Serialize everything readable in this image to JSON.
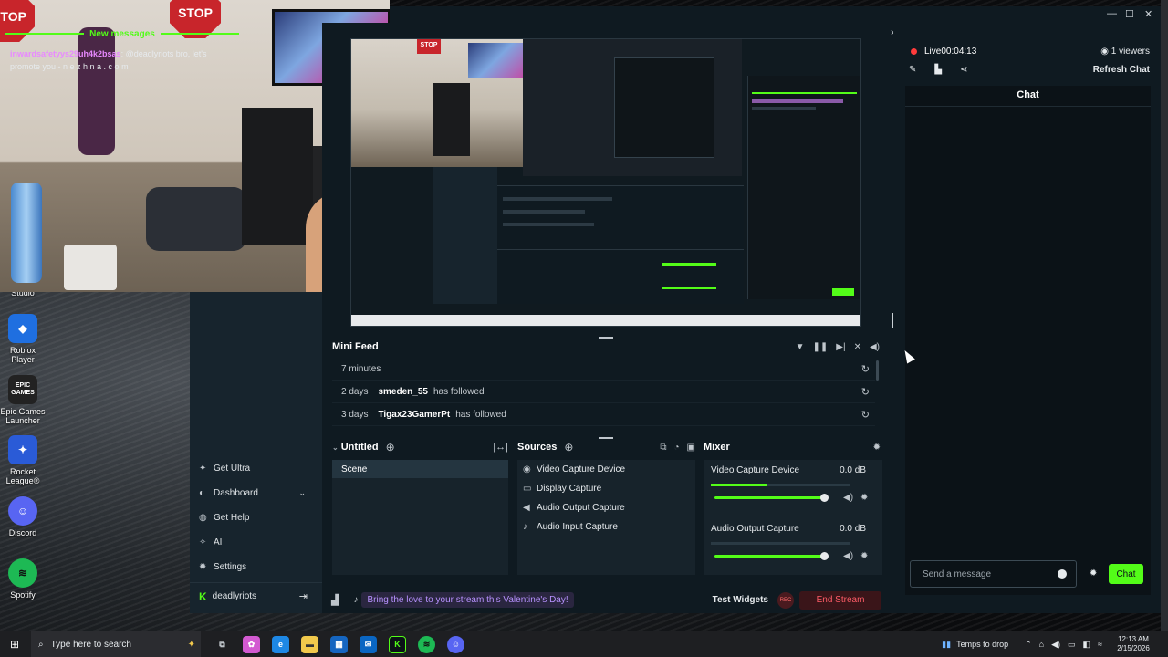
{
  "desktop": {
    "icons": [
      {
        "label": "Studio",
        "icon": "studio-icon"
      },
      {
        "label": "Roblox Player",
        "icon": "roblox-icon"
      },
      {
        "label": "Epic Games Launcher",
        "icon": "epic-games-icon"
      },
      {
        "label": "Rocket League®",
        "icon": "rocket-league-icon"
      },
      {
        "label": "Discord",
        "icon": "discord-icon"
      },
      {
        "label": "Spotify",
        "icon": "spotify-icon"
      }
    ],
    "epic_text": "EPIC GAMES"
  },
  "webcam": {
    "stop_sign": "STOP"
  },
  "preview": {
    "stop_sign": "STOP"
  },
  "nav": {
    "items": [
      {
        "label": "Get Ultra",
        "icon": "ultra-icon"
      },
      {
        "label": "Dashboard",
        "icon": "dashboard-icon"
      },
      {
        "label": "Get Help",
        "icon": "help-icon"
      },
      {
        "label": "AI",
        "icon": "ai-icon"
      },
      {
        "label": "Settings",
        "icon": "settings-icon"
      }
    ],
    "account": "deadlyriots"
  },
  "mini_feed": {
    "title": "Mini Feed",
    "rows": [
      {
        "time": "7 minutes",
        "user": "",
        "action": ""
      },
      {
        "time": "2 days",
        "user": "smeden_55",
        "action": "has followed"
      },
      {
        "time": "3 days",
        "user": "Tigax23GamerPt",
        "action": "has followed"
      }
    ]
  },
  "scenes": {
    "title": "Untitled",
    "items": [
      "Scene"
    ]
  },
  "sources": {
    "title": "Sources",
    "items": [
      {
        "label": "Video Capture Device",
        "icon": "camera-icon"
      },
      {
        "label": "Display Capture",
        "icon": "monitor-icon"
      },
      {
        "label": "Audio Output Capture",
        "icon": "speaker-icon"
      },
      {
        "label": "Audio Input Capture",
        "icon": "microphone-icon"
      }
    ]
  },
  "mixer": {
    "title": "Mixer",
    "channels": [
      {
        "name": "Video Capture Device",
        "db": "0.0 dB",
        "level": 0.4,
        "volume": 1.0
      },
      {
        "name": "Audio Output Capture",
        "db": "0.0 dB",
        "level": 0.0,
        "volume": 1.0
      }
    ]
  },
  "bottom_bar": {
    "promo": "Bring the love to your stream this Valentine's Day!",
    "test_widgets": "Test Widgets",
    "rec": "REC",
    "end_stream": "End Stream"
  },
  "live": {
    "status": "Live",
    "timer": "00:04:13",
    "viewers": "1 viewers"
  },
  "chat": {
    "refresh": "Refresh Chat",
    "title": "Chat",
    "new_messages": "New messages",
    "message": {
      "user": "inwardsafetyys29uh4k2bsas",
      "text": "@deadlyriots bro, let's promote you - n e z h n a . c o m"
    },
    "placeholder": "Send a message",
    "send": "Chat"
  },
  "taskbar": {
    "search_placeholder": "Type here to search",
    "weather": "Temps to drop",
    "time": "12:13 AM",
    "date": "2/15/2026"
  },
  "colors": {
    "accent": "#53fc18",
    "live": "#ff3b3b",
    "username": "#e889ff",
    "end_stream": "#ff5c67"
  }
}
